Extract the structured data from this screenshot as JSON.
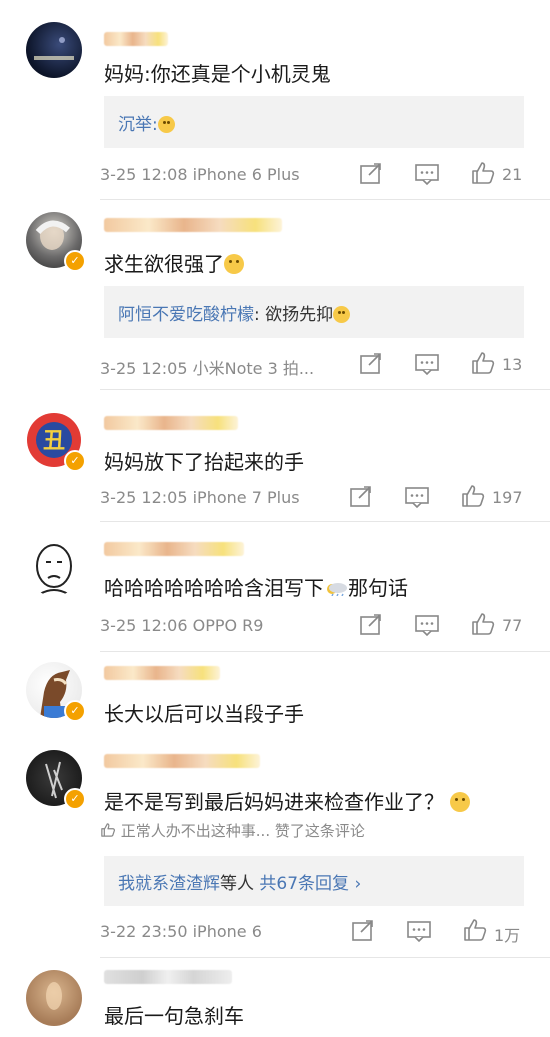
{
  "comments": [
    {
      "text": "妈妈:你还真是个小机灵鬼",
      "reply": {
        "author": "沉举",
        "separator": ":"
      },
      "time": "3-25 12:08",
      "device": "iPhone 6 Plus",
      "likes": "21"
    },
    {
      "text": "求生欲很强了",
      "reply": {
        "author": "阿恒不爱吃酸柠檬",
        "separator": ": ",
        "content": "欲扬先抑"
      },
      "time": "3-25 12:05",
      "device": "小米Note 3 拍...",
      "likes": "13"
    },
    {
      "text": "妈妈放下了抬起来的手",
      "time": "3-25 12:05",
      "device": "iPhone 7 Plus",
      "likes": "197"
    },
    {
      "text_before": "哈哈哈哈哈哈哈含泪写下",
      "text_after": "那句话",
      "time": "3-25 12:06",
      "device": "OPPO R9",
      "likes": "77"
    },
    {
      "text": "长大以后可以当段子手"
    },
    {
      "text": "是不是写到最后妈妈进来检查作业了？",
      "liked_by": "正常人办不出这种事...",
      "liked_suffix": "赞了这条评论",
      "reply_summary": {
        "names": "我就系渣渣辉",
        "suffix": "等人",
        "count_text": "共67条回复",
        "chevron": "›"
      },
      "time": "3-22 23:50",
      "device": "iPhone 6",
      "likes": "1万"
    },
    {
      "text": "最后一句急刹车"
    }
  ],
  "badges": {
    "avatar2": "✓",
    "avatar3": "✓",
    "avatar5": "✓",
    "avatar6": "✓",
    "avatar3_char": "丑"
  },
  "colors": {
    "link": "#4a77b4",
    "meta": "#8a8a8a",
    "reply_bg": "#f2f2f2",
    "vip_badge": "#f4a100"
  },
  "icons": {
    "share": "share-icon",
    "comment": "comment-icon",
    "like": "thumbs-up-icon"
  }
}
